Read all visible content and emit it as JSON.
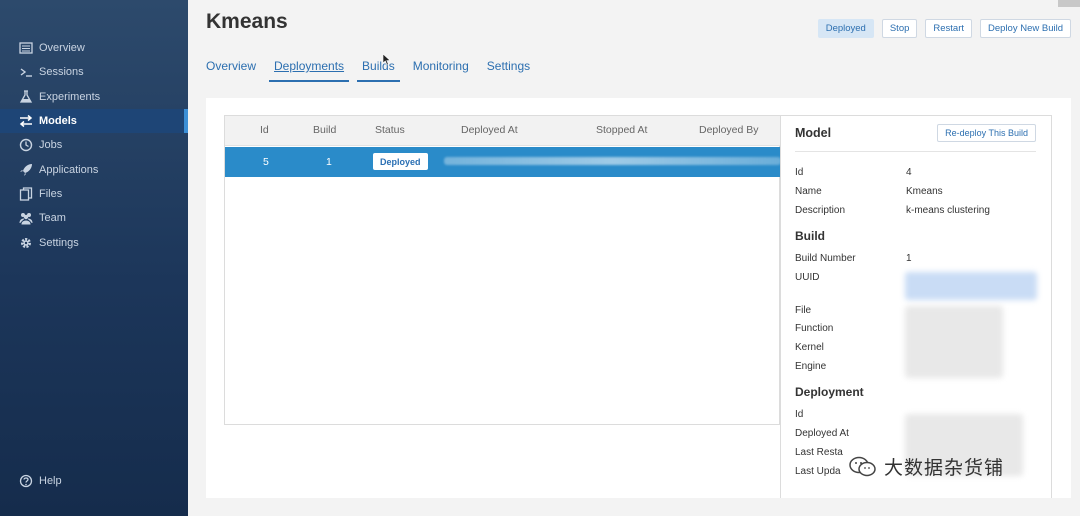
{
  "sidebar": {
    "items": [
      {
        "label": "Overview",
        "icon": "list-icon"
      },
      {
        "label": "Sessions",
        "icon": "terminal-icon"
      },
      {
        "label": "Experiments",
        "icon": "flask-icon"
      },
      {
        "label": "Models",
        "icon": "arrows-icon",
        "active": true
      },
      {
        "label": "Jobs",
        "icon": "clock-icon"
      },
      {
        "label": "Applications",
        "icon": "rocket-icon"
      },
      {
        "label": "Files",
        "icon": "files-icon"
      },
      {
        "label": "Team",
        "icon": "team-icon"
      },
      {
        "label": "Settings",
        "icon": "gear-icon"
      }
    ],
    "help_label": "Help"
  },
  "header": {
    "title": "Kmeans",
    "status_label": "Deployed",
    "stop_label": "Stop",
    "restart_label": "Restart",
    "deploy_new_label": "Deploy New Build"
  },
  "tabs": [
    {
      "label": "Overview"
    },
    {
      "label": "Deployments",
      "active": true
    },
    {
      "label": "Builds"
    },
    {
      "label": "Monitoring"
    },
    {
      "label": "Settings"
    }
  ],
  "table": {
    "columns": [
      "Id",
      "Build",
      "Status",
      "Deployed At",
      "Stopped At",
      "Deployed By"
    ],
    "rows": [
      {
        "id": "5",
        "build": "1",
        "status": "Deployed"
      }
    ]
  },
  "detail": {
    "title": "Model",
    "redeploy_label": "Re-deploy This Build",
    "model": {
      "id_label": "Id",
      "id_value": "4",
      "name_label": "Name",
      "name_value": "Kmeans",
      "description_label": "Description",
      "description_value": "k-means clustering"
    },
    "build_section": "Build",
    "build": {
      "number_label": "Build Number",
      "number_value": "1",
      "uuid_label": "UUID",
      "file_label": "File",
      "function_label": "Function",
      "kernel_label": "Kernel",
      "engine_label": "Engine"
    },
    "deployment_section": "Deployment",
    "deployment": {
      "id_label": "Id",
      "deployed_at_label": "Deployed At",
      "last_restart_label": "Last Resta",
      "last_update_label": "Last Upda"
    }
  },
  "watermark": {
    "text": "大数据杂货铺"
  },
  "colors": {
    "sidebar": "#1c365a",
    "active_item": "#1e4576",
    "selected_row": "#2a8bc9",
    "link": "#2c6fb0"
  }
}
